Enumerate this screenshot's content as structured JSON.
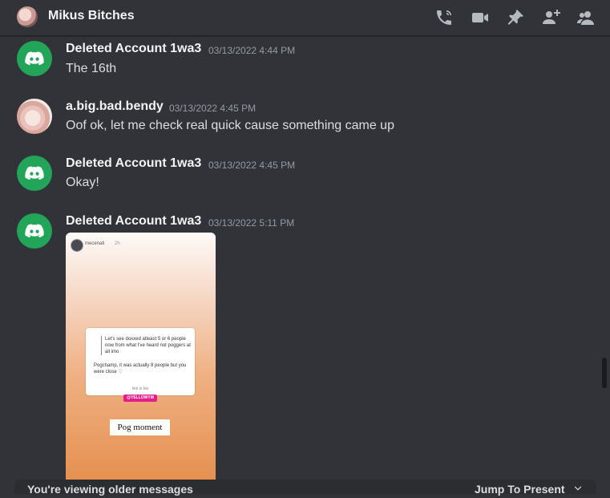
{
  "header": {
    "title": "Mikus Bitches",
    "icons": [
      "call-icon",
      "video-icon",
      "pin-icon",
      "add-member-icon",
      "member-list-icon"
    ]
  },
  "messages": [
    {
      "author": "Deleted Account 1wa3",
      "timestamp": "03/13/2022 4:44 PM",
      "content": "The 16th",
      "avatar": "discord-logo-icon"
    },
    {
      "author": "a.big.bad.bendy",
      "timestamp": "03/13/2022 4:45 PM",
      "content": "Oof ok, let me check real quick cause something came up",
      "avatar": "photo"
    },
    {
      "author": "Deleted Account 1wa3",
      "timestamp": "03/13/2022 4:45 PM",
      "content": "Okay!",
      "avatar": "discord-logo-icon"
    },
    {
      "author": "Deleted Account 1wa3",
      "timestamp": "03/13/2022 5:11 PM",
      "content": "",
      "avatar": "discord-logo-icon"
    }
  ],
  "attachment": {
    "story_user": "mecenati",
    "story_time": "2h",
    "question": "Let's see doxxed atleast 5 or 6 people now from what I've heard not poggers at all imo",
    "answer": "Pogchamp, it was actually 8 people but you were close ♡",
    "link_text": "link in bio",
    "tag": "@YELLOWYM",
    "caption": "Pog moment"
  },
  "bottom_bar": {
    "older_text": "You're viewing older messages",
    "jump_text": "Jump To Present"
  },
  "colors": {
    "background": "#313338",
    "discord_green": "#23a559",
    "text": "#dbdee1",
    "muted": "#949ba4"
  }
}
